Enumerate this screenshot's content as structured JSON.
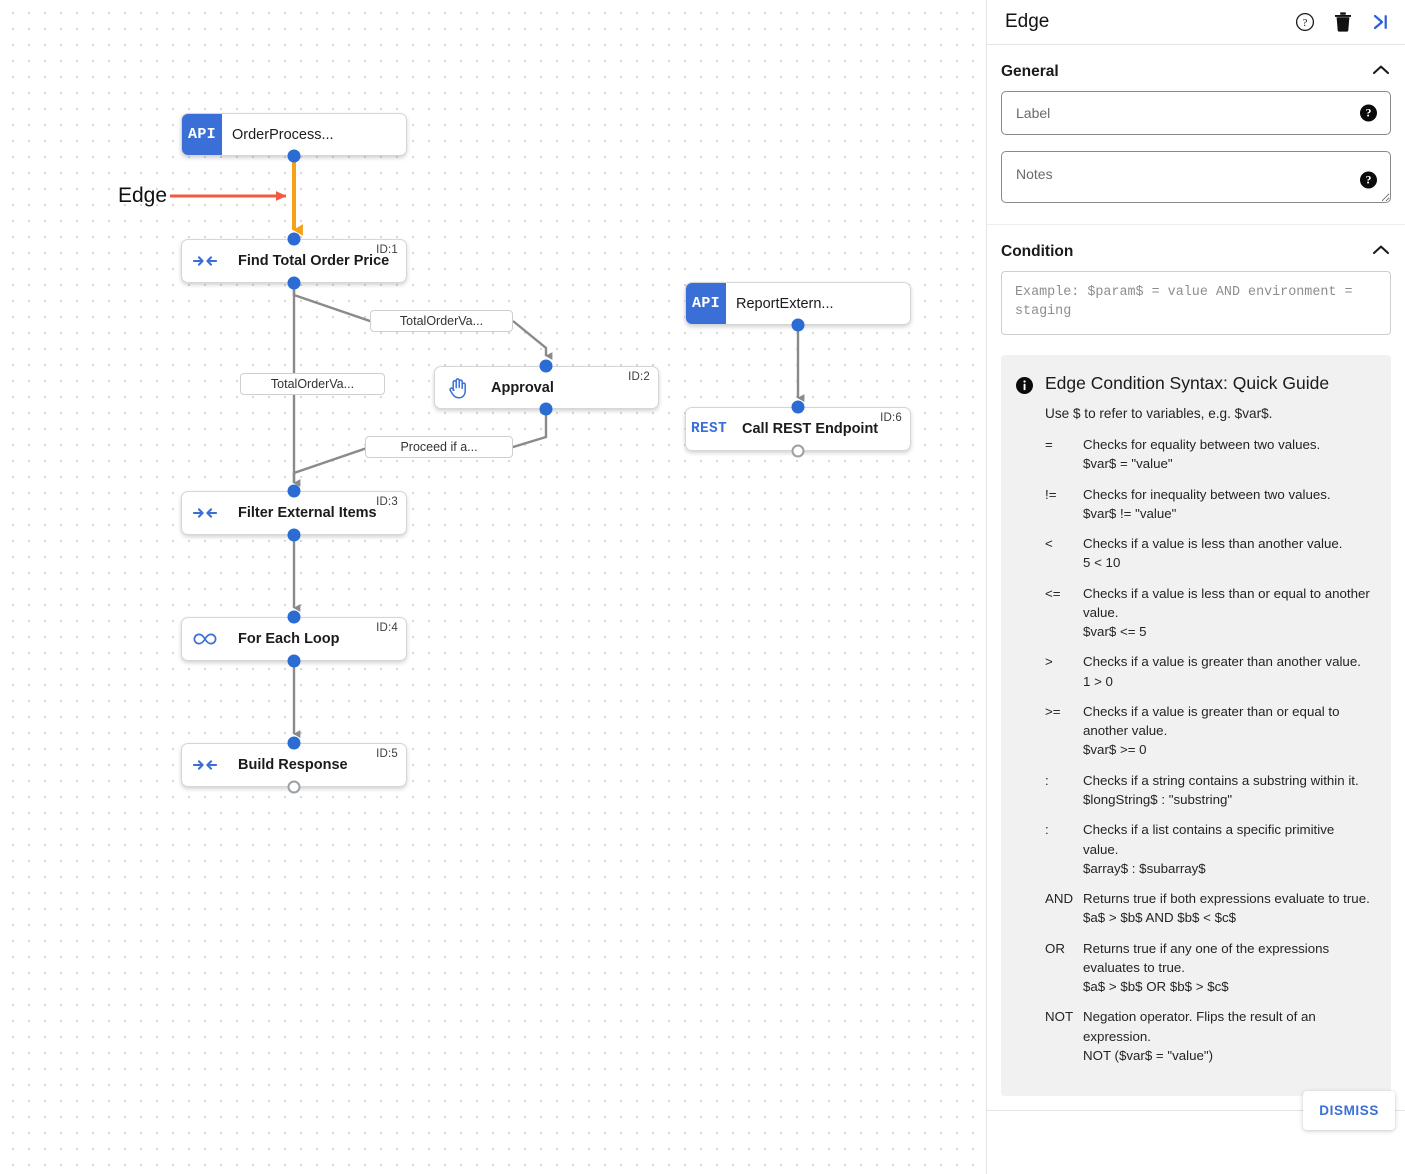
{
  "canvas": {
    "annotation": {
      "label": "Edge",
      "arrow_color": "#f4593f"
    },
    "highlight_edge_color": "#f5a218",
    "nodes": [
      {
        "id": "n0",
        "badge": "API",
        "badge_type": "api",
        "title": "OrderProcess...",
        "id_label": "",
        "bold": false
      },
      {
        "id": "n1",
        "icon": "merge-arrows-icon",
        "title": "Find Total Order Price",
        "id_label": "ID:1",
        "bold": true
      },
      {
        "id": "n2",
        "icon": "hand-icon",
        "title": "Approval",
        "id_label": "ID:2",
        "bold": true
      },
      {
        "id": "n3",
        "icon": "merge-arrows-icon",
        "title": "Filter External Items",
        "id_label": "ID:3",
        "bold": true
      },
      {
        "id": "n4",
        "icon": "infinity-icon",
        "title": "For Each Loop",
        "id_label": "ID:4",
        "bold": true
      },
      {
        "id": "n5",
        "icon": "merge-arrows-icon",
        "title": "Build Response",
        "id_label": "ID:5",
        "bold": true
      },
      {
        "id": "n6",
        "badge": "API",
        "badge_type": "api",
        "title": "ReportExtern...",
        "id_label": "",
        "bold": false
      },
      {
        "id": "n7",
        "badge": "REST",
        "badge_type": "rest",
        "title": "Call REST Endpoint",
        "id_label": "ID:6",
        "bold": true
      }
    ],
    "edge_labels": [
      {
        "text": "TotalOrderVa..."
      },
      {
        "text": "TotalOrderVa..."
      },
      {
        "text": "Proceed if a..."
      }
    ]
  },
  "panel": {
    "title": "Edge",
    "header_icons": [
      {
        "name": "help-icon",
        "glyph": "?"
      },
      {
        "name": "delete-icon",
        "glyph": "trash"
      },
      {
        "name": "collapse-panel-icon",
        "glyph": ">|"
      }
    ],
    "general": {
      "heading": "General",
      "label_field": {
        "placeholder": "Label",
        "value": ""
      },
      "notes_field": {
        "placeholder": "Notes",
        "value": ""
      },
      "help_glyph": "?"
    },
    "condition": {
      "heading": "Condition",
      "placeholder": "Example: $param$ = value AND environment = staging",
      "value": ""
    },
    "guide": {
      "title": "Edge Condition Syntax: Quick Guide",
      "intro": "Use $ to refer to variables, e.g. $var$.",
      "operators": [
        {
          "symbol": "=",
          "description": "Checks for equality between two values.",
          "example": "$var$ = \"value\""
        },
        {
          "symbol": "!=",
          "description": "Checks for inequality between two values.",
          "example": "$var$ != \"value\""
        },
        {
          "symbol": "<",
          "description": "Checks if a value is less than another value.",
          "example": "5 < 10"
        },
        {
          "symbol": "<=",
          "description": "Checks if a value is less than or equal to another value.",
          "example": "$var$ <= 5"
        },
        {
          "symbol": ">",
          "description": "Checks if a value is greater than another value.",
          "example": "1 > 0"
        },
        {
          "symbol": ">=",
          "description": "Checks if a value is greater than or equal to another value.",
          "example": "$var$ >= 0"
        },
        {
          "symbol": ":",
          "description": "Checks if a string contains a substring within it.",
          "example": "$longString$ : \"substring\""
        },
        {
          "symbol": ":",
          "description": "Checks if a list contains a specific primitive value.",
          "example": "$array$ : $subarray$"
        },
        {
          "symbol": "AND",
          "description": "Returns true if both expressions evaluate to true.",
          "example": "$a$ > $b$ AND $b$ < $c$"
        },
        {
          "symbol": "OR",
          "description": "Returns true if any one of the expressions evaluates to true.",
          "example": "$a$ > $b$ OR $b$ > $c$"
        },
        {
          "symbol": "NOT",
          "description": "Negation operator. Flips the result of an expression.",
          "example": "NOT ($var$ = \"value\")"
        }
      ]
    },
    "dismiss_label": "DISMISS",
    "accent_color": "#3a6fd8"
  }
}
